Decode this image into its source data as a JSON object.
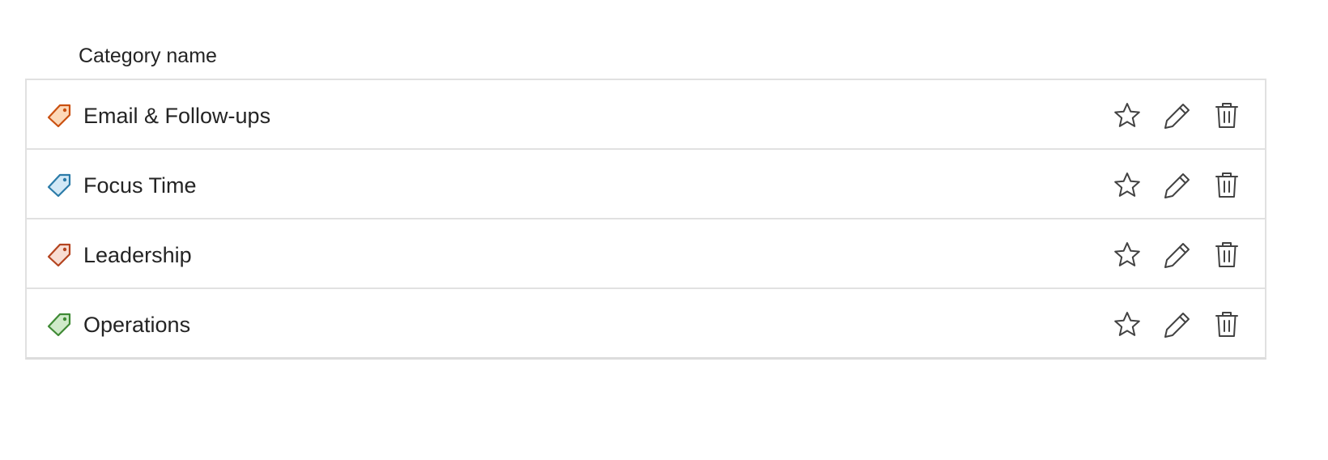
{
  "header": {
    "column_label": "Category name"
  },
  "categories": [
    {
      "label": "Email & Follow-ups",
      "color": "#ca5010",
      "fill": "#fcd8b8",
      "icon": "tag-icon"
    },
    {
      "label": "Focus Time",
      "color": "#2b7ba8",
      "fill": "#d2e8f6",
      "icon": "tag-icon"
    },
    {
      "label": "Leadership",
      "color": "#b4441f",
      "fill": "#f8ddd3",
      "icon": "tag-icon"
    },
    {
      "label": "Operations",
      "color": "#3f8a35",
      "fill": "#cfeac9",
      "icon": "tag-icon"
    }
  ],
  "actions": {
    "star_icon": "star-icon",
    "edit_icon": "pencil-icon",
    "delete_icon": "trash-icon",
    "icon_color": "#424242"
  }
}
